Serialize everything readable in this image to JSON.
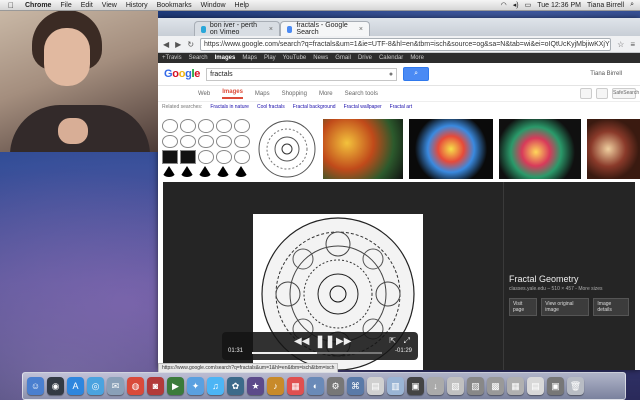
{
  "menubar": {
    "apple": "",
    "items": [
      "Chrome",
      "File",
      "Edit",
      "View",
      "History",
      "Bookmarks",
      "Window",
      "Help"
    ],
    "clock": "Tue 12:36 PM",
    "user": "Tiana Birrell"
  },
  "browser": {
    "tabs": [
      {
        "title": "bon iver - perth on Vimeo",
        "color": "#2aa7d9"
      },
      {
        "title": "fractals - Google Search",
        "color": "#4a8af4"
      }
    ],
    "url": "https://www.google.com/search?q=fractals&um=1&ie=UTF-8&hl=en&tbm=isch&source=og&sa=N&tab=wi&ei=oIQtUcKyjMbjiwKXjYGwAg&biw=11",
    "gbar": [
      "+Travis",
      "Search",
      "Images",
      "Maps",
      "Play",
      "YouTube",
      "News",
      "Gmail",
      "Drive",
      "Calendar",
      "More"
    ],
    "gbar_active": "Images",
    "logo": [
      "G",
      "o",
      "o",
      "g",
      "l",
      "e"
    ],
    "search_value": "fractals",
    "search_user": "Tiana Birrell",
    "nav": [
      "Web",
      "Images",
      "Maps",
      "Shopping",
      "More",
      "Search tools"
    ],
    "nav_selected": "Images",
    "related_label": "Related searches:",
    "related": [
      "Fractals in nature",
      "Cool fractals",
      "Fractal background",
      "Fractal wallpaper",
      "Fractal art"
    ],
    "safesearch": "SafeSearch",
    "preview": {
      "title": "Fractal Geometry",
      "source": "classes.yale.edu",
      "meta": "510 × 457 - More sizes",
      "buttons": [
        "Visit page",
        "View original image",
        "Image details"
      ]
    },
    "status": "https://www.google.com/search?q=fractals&um=1&hl=en&tbm=isch&tbm=isch"
  },
  "video": {
    "current": "01:31",
    "remaining": "-01:29",
    "progress": 0.5
  },
  "dock": [
    {
      "icon": "finder-icon",
      "color": "#4a7fcf",
      "glyph": "☺"
    },
    {
      "icon": "dashboard-icon",
      "color": "#333a44",
      "glyph": "◉"
    },
    {
      "icon": "app-store-icon",
      "color": "#2e86de",
      "glyph": "A"
    },
    {
      "icon": "safari-icon",
      "color": "#4aa3df",
      "glyph": "◎"
    },
    {
      "icon": "mail-icon",
      "color": "#8aa0b8",
      "glyph": "✉"
    },
    {
      "icon": "chrome-icon",
      "color": "#d94a3a",
      "glyph": "◍"
    },
    {
      "icon": "photobooth-icon",
      "color": "#b23a3a",
      "glyph": "◙"
    },
    {
      "icon": "facetime-icon",
      "color": "#3b7b3b",
      "glyph": "▶"
    },
    {
      "icon": "messages-icon",
      "color": "#5aa0e0",
      "glyph": "✦"
    },
    {
      "icon": "itunes-icon",
      "color": "#4cb5f5",
      "glyph": "♫"
    },
    {
      "icon": "iphoto-icon",
      "color": "#3c6a8a",
      "glyph": "✿"
    },
    {
      "icon": "imovie-icon",
      "color": "#5c4a8a",
      "glyph": "★"
    },
    {
      "icon": "garageband-icon",
      "color": "#c88a2a",
      "glyph": "♪"
    },
    {
      "icon": "calendar-icon",
      "color": "#e05050",
      "glyph": "▦"
    },
    {
      "icon": "preview-icon",
      "color": "#6a8ab8",
      "glyph": "◐"
    },
    {
      "icon": "system-prefs-icon",
      "color": "#777",
      "glyph": "⚙"
    },
    {
      "icon": "utilities-icon",
      "color": "#5a7aa8",
      "glyph": "⌘"
    },
    {
      "icon": "documents-icon",
      "color": "#d0d0d0",
      "glyph": "▤"
    },
    {
      "icon": "folder-icon",
      "color": "#9ab4d4",
      "glyph": "▥"
    },
    {
      "icon": "screenshot-icon",
      "color": "#444",
      "glyph": "▣"
    },
    {
      "icon": "downloads-icon",
      "color": "#aaa",
      "glyph": "↓"
    },
    {
      "icon": "stack-icon",
      "color": "#c0c0c0",
      "glyph": "▧"
    },
    {
      "icon": "stack-icon-2",
      "color": "#888",
      "glyph": "▨"
    },
    {
      "icon": "stack-icon-3",
      "color": "#999",
      "glyph": "▩"
    },
    {
      "icon": "stack-icon-4",
      "color": "#b0b0b0",
      "glyph": "▦"
    },
    {
      "icon": "stack-icon-5",
      "color": "#d8d8d8",
      "glyph": "▤"
    },
    {
      "icon": "stack-icon-6",
      "color": "#777",
      "glyph": "▣"
    },
    {
      "icon": "trash-icon",
      "color": "#b8bcc4",
      "glyph": "🗑"
    }
  ]
}
